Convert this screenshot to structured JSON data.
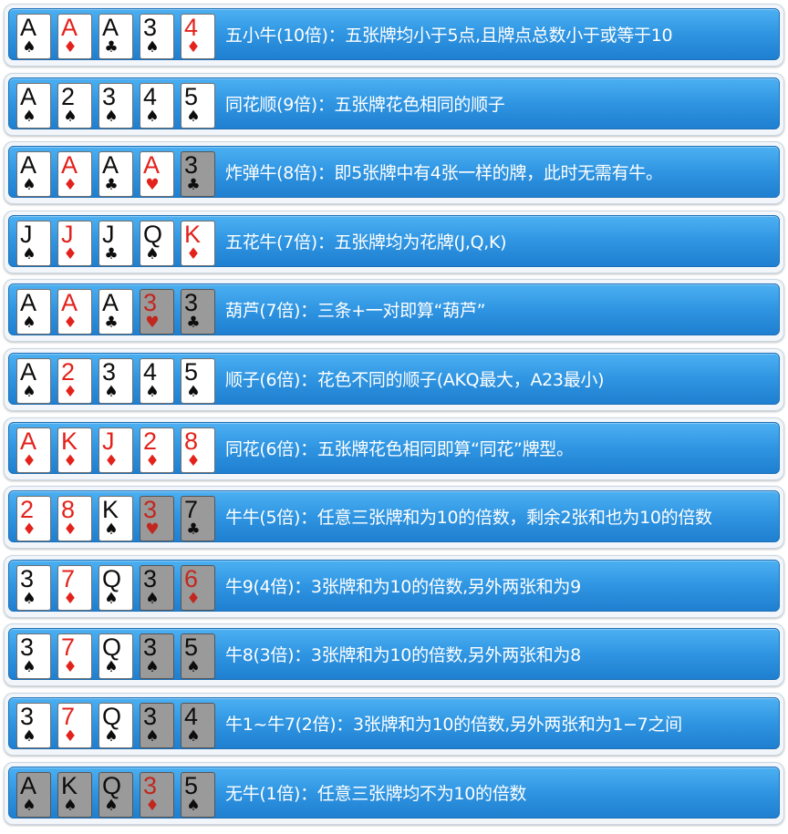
{
  "colors": {
    "row_blue": "#2f95e2",
    "red_suit": "#e3221b",
    "black_suit": "#0d0d0d",
    "dim_card": "#9a9a9a"
  },
  "rows": [
    {
      "desc": "五小牛(10倍)：五张牌均小于5点,且牌点总数小于或等于10",
      "cards": [
        {
          "rank": "A",
          "suit": "♠",
          "color": "black",
          "dim": false
        },
        {
          "rank": "A",
          "suit": "♦",
          "color": "red",
          "dim": false
        },
        {
          "rank": "A",
          "suit": "♣",
          "color": "black",
          "dim": false
        },
        {
          "rank": "3",
          "suit": "♠",
          "color": "black",
          "dim": false
        },
        {
          "rank": "4",
          "suit": "♦",
          "color": "red",
          "dim": false
        }
      ]
    },
    {
      "desc": "同花顺(9倍)：五张牌花色相同的顺子",
      "cards": [
        {
          "rank": "A",
          "suit": "♠",
          "color": "black",
          "dim": false
        },
        {
          "rank": "2",
          "suit": "♠",
          "color": "black",
          "dim": false
        },
        {
          "rank": "3",
          "suit": "♠",
          "color": "black",
          "dim": false
        },
        {
          "rank": "4",
          "suit": "♠",
          "color": "black",
          "dim": false
        },
        {
          "rank": "5",
          "suit": "♠",
          "color": "black",
          "dim": false
        }
      ]
    },
    {
      "desc": "炸弹牛(8倍)：即5张牌中有4张一样的牌，此时无需有牛。",
      "cards": [
        {
          "rank": "A",
          "suit": "♠",
          "color": "black",
          "dim": false
        },
        {
          "rank": "A",
          "suit": "♦",
          "color": "red",
          "dim": false
        },
        {
          "rank": "A",
          "suit": "♣",
          "color": "black",
          "dim": false
        },
        {
          "rank": "A",
          "suit": "♥",
          "color": "red",
          "dim": false
        },
        {
          "rank": "3",
          "suit": "♣",
          "color": "black",
          "dim": true
        }
      ]
    },
    {
      "desc": "五花牛(7倍)：五张牌均为花牌(J,Q,K)",
      "cards": [
        {
          "rank": "J",
          "suit": "♠",
          "color": "black",
          "dim": false
        },
        {
          "rank": "J",
          "suit": "♦",
          "color": "red",
          "dim": false
        },
        {
          "rank": "J",
          "suit": "♣",
          "color": "black",
          "dim": false
        },
        {
          "rank": "Q",
          "suit": "♠",
          "color": "black",
          "dim": false
        },
        {
          "rank": "K",
          "suit": "♦",
          "color": "red",
          "dim": false
        }
      ]
    },
    {
      "desc": "葫芦(7倍)：三条+一对即算“葫芦”",
      "cards": [
        {
          "rank": "A",
          "suit": "♠",
          "color": "black",
          "dim": false
        },
        {
          "rank": "A",
          "suit": "♦",
          "color": "red",
          "dim": false
        },
        {
          "rank": "A",
          "suit": "♣",
          "color": "black",
          "dim": false
        },
        {
          "rank": "3",
          "suit": "♥",
          "color": "red",
          "dim": true
        },
        {
          "rank": "3",
          "suit": "♣",
          "color": "black",
          "dim": true
        }
      ]
    },
    {
      "desc": "顺子(6倍)：花色不同的顺子(AKQ最大，A23最小)",
      "cards": [
        {
          "rank": "A",
          "suit": "♠",
          "color": "black",
          "dim": false
        },
        {
          "rank": "2",
          "suit": "♦",
          "color": "red",
          "dim": false
        },
        {
          "rank": "3",
          "suit": "♠",
          "color": "black",
          "dim": false
        },
        {
          "rank": "4",
          "suit": "♠",
          "color": "black",
          "dim": false
        },
        {
          "rank": "5",
          "suit": "♠",
          "color": "black",
          "dim": false
        }
      ]
    },
    {
      "desc": "同花(6倍)：五张牌花色相同即算“同花”牌型。",
      "cards": [
        {
          "rank": "A",
          "suit": "♦",
          "color": "red",
          "dim": false
        },
        {
          "rank": "K",
          "suit": "♦",
          "color": "red",
          "dim": false
        },
        {
          "rank": "J",
          "suit": "♦",
          "color": "red",
          "dim": false
        },
        {
          "rank": "2",
          "suit": "♦",
          "color": "red",
          "dim": false
        },
        {
          "rank": "8",
          "suit": "♦",
          "color": "red",
          "dim": false
        }
      ]
    },
    {
      "desc": "牛牛(5倍)：任意三张牌和为10的倍数，剩余2张和也为10的倍数",
      "cards": [
        {
          "rank": "2",
          "suit": "♦",
          "color": "red",
          "dim": false
        },
        {
          "rank": "8",
          "suit": "♦",
          "color": "red",
          "dim": false
        },
        {
          "rank": "K",
          "suit": "♠",
          "color": "black",
          "dim": false
        },
        {
          "rank": "3",
          "suit": "♥",
          "color": "red",
          "dim": true
        },
        {
          "rank": "7",
          "suit": "♣",
          "color": "black",
          "dim": true
        }
      ]
    },
    {
      "desc": "牛9(4倍)：3张牌和为10的倍数,另外两张和为9",
      "cards": [
        {
          "rank": "3",
          "suit": "♠",
          "color": "black",
          "dim": false
        },
        {
          "rank": "7",
          "suit": "♦",
          "color": "red",
          "dim": false
        },
        {
          "rank": "Q",
          "suit": "♠",
          "color": "black",
          "dim": false
        },
        {
          "rank": "3",
          "suit": "♠",
          "color": "black",
          "dim": true
        },
        {
          "rank": "6",
          "suit": "♦",
          "color": "red",
          "dim": true
        }
      ]
    },
    {
      "desc": "牛8(3倍)：3张牌和为10的倍数,另外两张和为8",
      "cards": [
        {
          "rank": "3",
          "suit": "♠",
          "color": "black",
          "dim": false
        },
        {
          "rank": "7",
          "suit": "♦",
          "color": "red",
          "dim": false
        },
        {
          "rank": "Q",
          "suit": "♠",
          "color": "black",
          "dim": false
        },
        {
          "rank": "3",
          "suit": "♠",
          "color": "black",
          "dim": true
        },
        {
          "rank": "5",
          "suit": "♠",
          "color": "black",
          "dim": true
        }
      ]
    },
    {
      "desc": "牛1~牛7(2倍)：3张牌和为10的倍数,另外两张和为1−7之间",
      "cards": [
        {
          "rank": "3",
          "suit": "♠",
          "color": "black",
          "dim": false
        },
        {
          "rank": "7",
          "suit": "♦",
          "color": "red",
          "dim": false
        },
        {
          "rank": "Q",
          "suit": "♠",
          "color": "black",
          "dim": false
        },
        {
          "rank": "3",
          "suit": "♠",
          "color": "black",
          "dim": true
        },
        {
          "rank": "4",
          "suit": "♠",
          "color": "black",
          "dim": true
        }
      ]
    },
    {
      "desc": "无牛(1倍)：任意三张牌均不为10的倍数",
      "cards": [
        {
          "rank": "A",
          "suit": "♠",
          "color": "black",
          "dim": true
        },
        {
          "rank": "K",
          "suit": "♠",
          "color": "black",
          "dim": true
        },
        {
          "rank": "Q",
          "suit": "♠",
          "color": "black",
          "dim": true
        },
        {
          "rank": "3",
          "suit": "♦",
          "color": "red",
          "dim": true
        },
        {
          "rank": "5",
          "suit": "♠",
          "color": "black",
          "dim": true
        }
      ]
    }
  ]
}
